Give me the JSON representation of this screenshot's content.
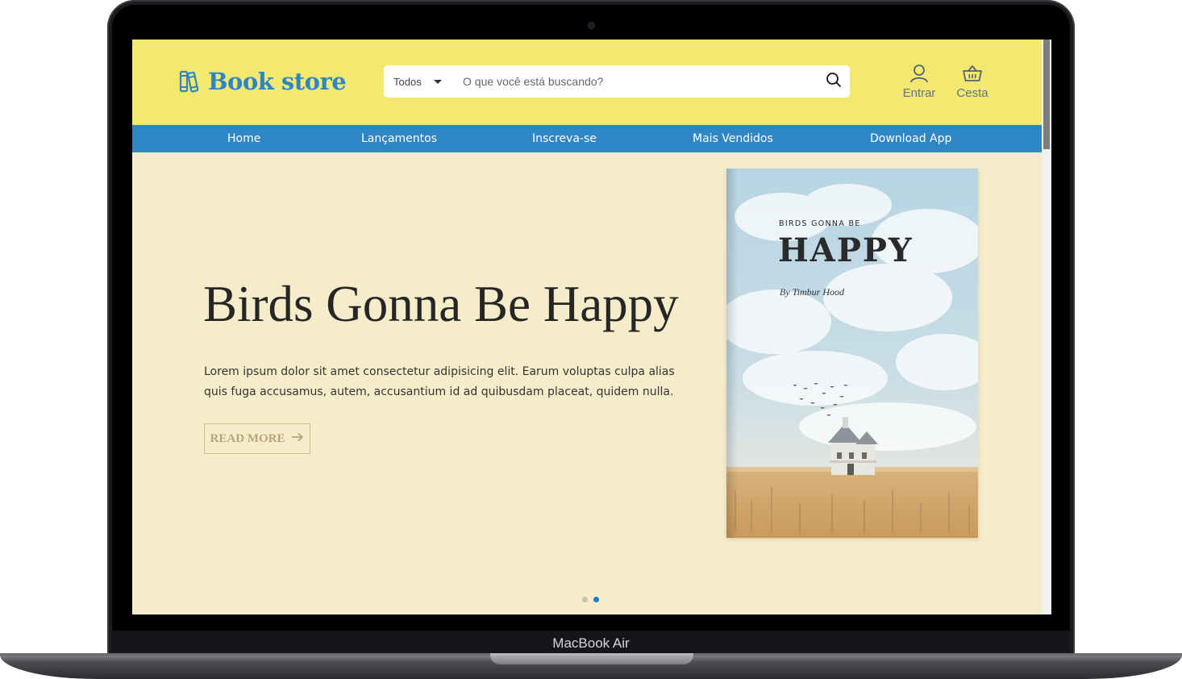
{
  "device": {
    "label": "MacBook Air"
  },
  "header": {
    "logo_text": "Book store",
    "search": {
      "category": "Todos",
      "placeholder": "O que você está buscando?"
    },
    "account_label": "Entrar",
    "cart_label": "Cesta"
  },
  "nav": {
    "items": [
      "Home",
      "Lançamentos",
      "Inscreva-se",
      "Mais Vendidos",
      "Download App"
    ]
  },
  "hero": {
    "title": "Birds Gonna Be Happy",
    "text": "Lorem ipsum dolor sit amet consectetur adipisicing elit. Earum voluptas culpa alias quis fuga accusamus, autem, accusantium id ad quibusdam placeat, quidem nulla.",
    "button_label": "READ MORE",
    "book": {
      "top_text": "BIRDS GONNA BE",
      "title": "HAPPY",
      "author": "By Timbur Hood"
    }
  },
  "carousel": {
    "slide_count": 2,
    "active_index": 1
  },
  "colors": {
    "header_bg": "#f4e970",
    "nav_bg": "#2f86c5",
    "hero_bg": "#f5edc9",
    "accent": "#2f86c5"
  }
}
